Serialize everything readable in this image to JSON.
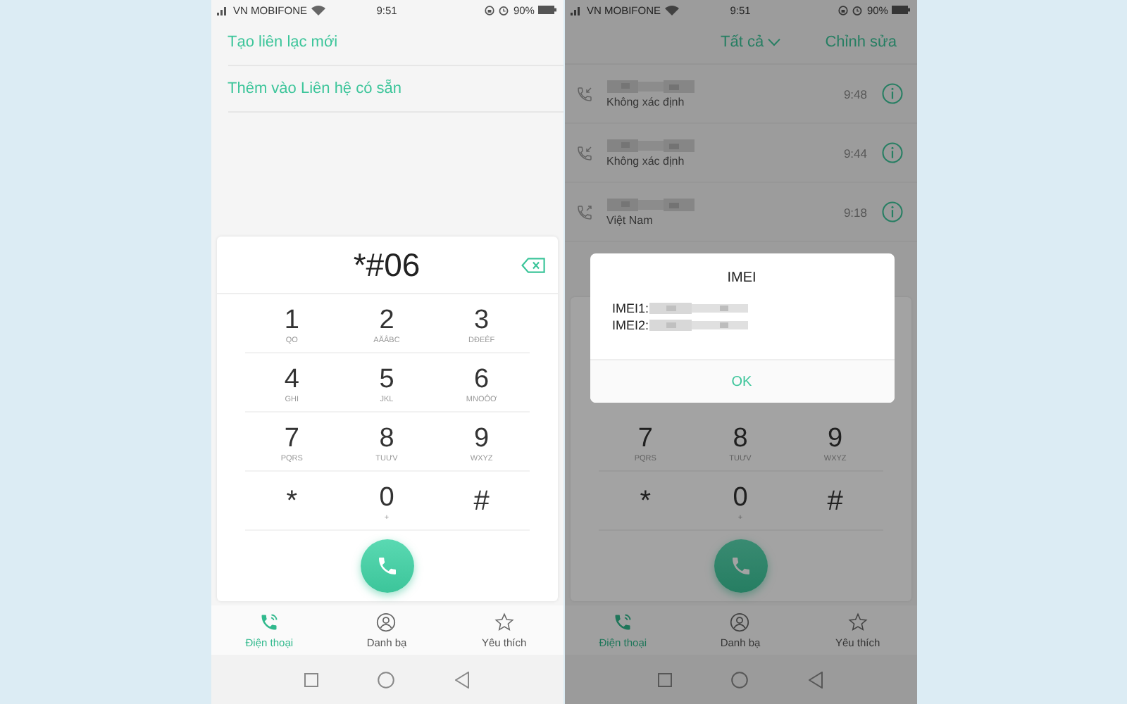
{
  "left_screen": {
    "status_bar": {
      "carrier": "VN MOBIFONE",
      "time": "9:51",
      "battery": "90%"
    },
    "menu_items": [
      {
        "label": "Tạo liên lạc mới"
      },
      {
        "label": "Thêm vào Liên hệ có sẵn"
      }
    ],
    "display": "*#06",
    "keys": [
      {
        "digit": "1",
        "letters": "QO"
      },
      {
        "digit": "2",
        "letters": "AĂÂBC"
      },
      {
        "digit": "3",
        "letters": "DĐEÊF"
      },
      {
        "digit": "4",
        "letters": "GHI"
      },
      {
        "digit": "5",
        "letters": "JKL"
      },
      {
        "digit": "6",
        "letters": "MNOÔƠ"
      },
      {
        "digit": "7",
        "letters": "PQRS"
      },
      {
        "digit": "8",
        "letters": "TUƯV"
      },
      {
        "digit": "9",
        "letters": "WXYZ"
      },
      {
        "digit": "*"
      },
      {
        "digit": "0",
        "letters": "+"
      },
      {
        "digit": "#"
      }
    ],
    "tabs": [
      {
        "label": "Điện thoại",
        "selected": true
      },
      {
        "label": "Danh bạ",
        "selected": false
      },
      {
        "label": "Yêu thích",
        "selected": false
      }
    ]
  },
  "right_screen": {
    "status_bar": {
      "carrier": "VN MOBIFONE",
      "time": "9:51",
      "battery": "90%"
    },
    "filter": "Tất cả",
    "edit_button": "Chỉnh sửa",
    "calls": [
      {
        "kind": "incoming",
        "location": "Không xác định",
        "time": "9:48"
      },
      {
        "kind": "incoming",
        "location": "Không xác định",
        "time": "9:44"
      },
      {
        "kind": "outgoing",
        "location": "Việt Nam",
        "time": "9:18"
      }
    ],
    "keys": [
      {
        "digit": "7",
        "letters": "PQRS"
      },
      {
        "digit": "8",
        "letters": "TUƯV"
      },
      {
        "digit": "9",
        "letters": "WXYZ"
      },
      {
        "digit": "*"
      },
      {
        "digit": "0",
        "letters": "+"
      },
      {
        "digit": "#"
      }
    ],
    "tabs": [
      {
        "label": "Điện thoại",
        "selected": true
      },
      {
        "label": "Danh bạ",
        "selected": false
      },
      {
        "label": "Yêu thích",
        "selected": false
      }
    ],
    "dialog": {
      "title": "IMEI",
      "lines": [
        "IMEI1:",
        "IMEI2:"
      ],
      "button": "OK"
    }
  }
}
